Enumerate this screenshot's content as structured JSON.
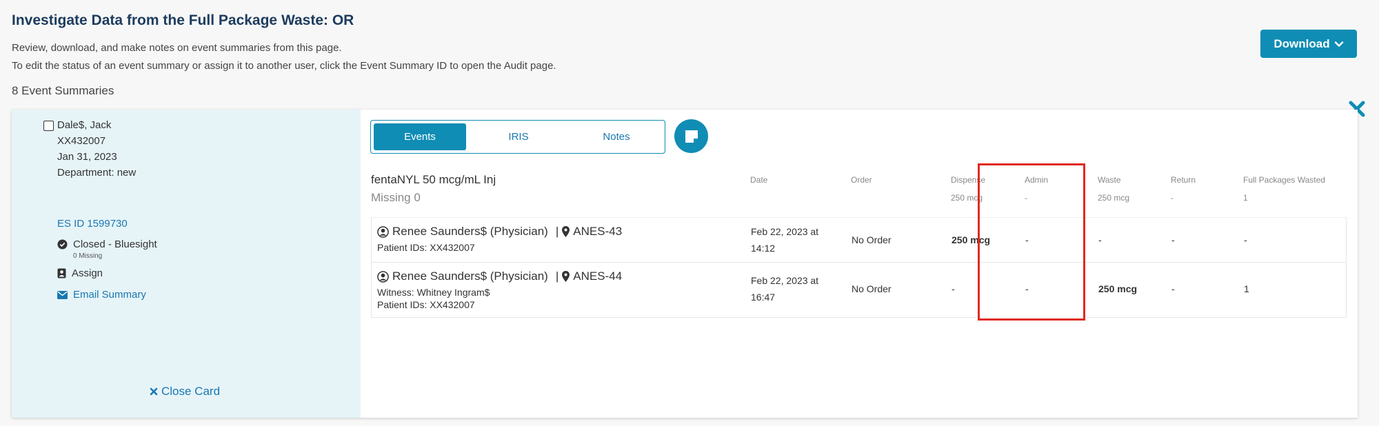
{
  "page": {
    "title": "Investigate Data from the Full Package Waste: OR",
    "desc_line1": "Review, download, and make notes on event summaries from this page.",
    "desc_line2": "To edit the status of an event summary or assign it to another user, click the Event Summary ID to open the Audit page.",
    "count_text": "8 Event Summaries",
    "download_label": "Download"
  },
  "card": {
    "patient_name": "Dale$, Jack",
    "patient_id": "XX432007",
    "date": "Jan 31, 2023",
    "department": "Department: new",
    "es_id": "ES ID 1599730",
    "status": "Closed - Bluesight",
    "missing": "0 Missing",
    "assign_label": "Assign",
    "email_label": "Email Summary",
    "close_card_label": "Close Card"
  },
  "tabs": [
    {
      "label": "Events",
      "active": true
    },
    {
      "label": "IRIS",
      "active": false
    },
    {
      "label": "Notes",
      "active": false
    }
  ],
  "drug": {
    "name": "fentaNYL 50 mcg/mL Inj",
    "missing": "Missing 0"
  },
  "columns": {
    "date": "Date",
    "order": "Order",
    "dispense": "Dispense",
    "admin": "Admin",
    "waste": "Waste",
    "return": "Return",
    "full_packages": "Full Packages Wasted"
  },
  "totals": {
    "dispense": "250 mcg",
    "admin": "-",
    "waste": "250 mcg",
    "return": "-",
    "full_packages": "1"
  },
  "rows": [
    {
      "person": "Renee Saunders$ (Physician)",
      "location": "ANES-43",
      "witness": "",
      "patient_ids": "Patient IDs: XX432007",
      "date_line1": "Feb 22, 2023 at",
      "date_line2": "14:12",
      "order": "No Order",
      "dispense": "250 mcg",
      "admin": "-",
      "waste": "-",
      "return": "-",
      "full_packages": "-"
    },
    {
      "person": "Renee Saunders$ (Physician)",
      "location": "ANES-44",
      "witness": "Witness: Whitney Ingram$",
      "patient_ids": "Patient IDs: XX432007",
      "date_line1": "Feb 22, 2023 at",
      "date_line2": "16:47",
      "order": "No Order",
      "dispense": "-",
      "admin": "-",
      "waste": "250 mcg",
      "return": "-",
      "full_packages": "1"
    }
  ],
  "colors": {
    "accent": "#0f8db4",
    "link": "#1a77b0",
    "title": "#1d3c5e",
    "highlight": "#e02a1d",
    "card_left_bg": "#e6f4f8"
  },
  "icons": [
    "chevron-down-icon",
    "close-icon",
    "checkbox-icon",
    "check-circle-icon",
    "assign-user-icon",
    "envelope-icon",
    "note-icon",
    "user-circle-icon",
    "map-pin-icon"
  ]
}
